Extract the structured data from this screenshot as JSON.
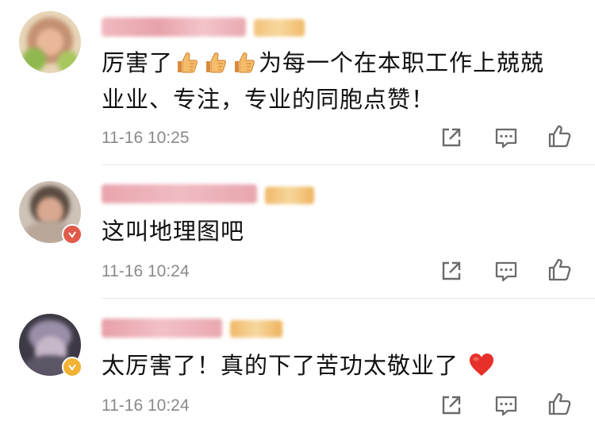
{
  "comments": [
    {
      "text_part1": "厉害了",
      "text_part2": "为每一个在本职工作上兢兢",
      "text_line2": "业业、专注，专业的同胞点赞！",
      "time": "11-16 10:25"
    },
    {
      "text": "这叫地理图吧",
      "time": "11-16 10:24"
    },
    {
      "text": "太厉害了！真的下了苦功太敬业了",
      "time": "11-16 10:24"
    }
  ],
  "icons": {
    "share": "share-icon",
    "reply": "reply-icon",
    "like": "thumbs-up-icon",
    "emoji": "thumbs-up-emoji-icon",
    "heart": "heart-emoji-icon",
    "verified": "verified-v-icon"
  },
  "colors": {
    "text": "#111111",
    "time": "#8a8a8a",
    "icon": "#6b6b6b",
    "divider": "#e8e8e8",
    "heart": "#e8302b",
    "thumb": "#f2b05a"
  }
}
